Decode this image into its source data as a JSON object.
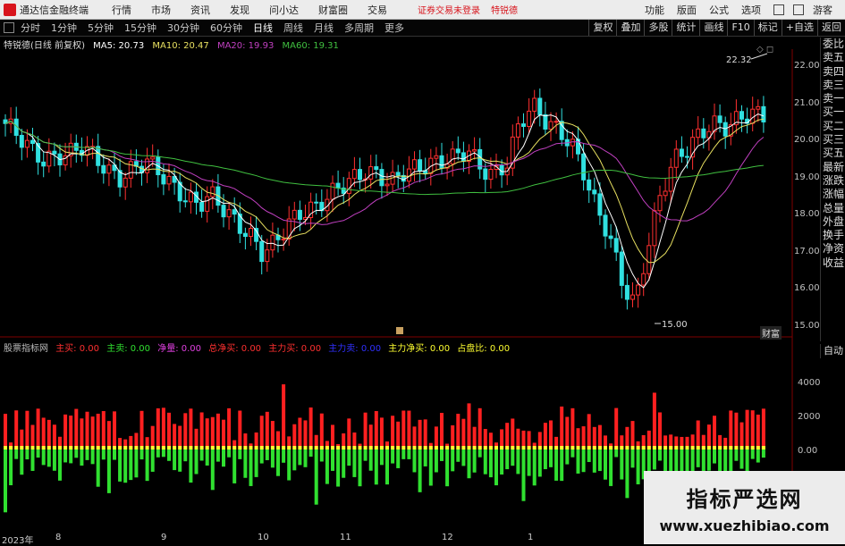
{
  "menubar": {
    "app_title": "通达信金融终端",
    "items": [
      "行情",
      "市场",
      "资讯",
      "发现",
      "问小达",
      "财富圈",
      "交易"
    ],
    "notice": "证券交易未登录",
    "notice2": "特锐德",
    "right": [
      "功能",
      "版面",
      "公式",
      "选项",
      "游客"
    ]
  },
  "periodbar": {
    "periods": [
      "分时",
      "1分钟",
      "5分钟",
      "15分钟",
      "30分钟",
      "60分钟",
      "日线",
      "周线",
      "月线",
      "多周期",
      "更多"
    ],
    "selected": "日线",
    "tools": [
      "复权",
      "叠加",
      "多股",
      "统计",
      "画线",
      "F10",
      "标记",
      "+自选",
      "返回"
    ]
  },
  "main_chart": {
    "stock": "特锐德(日线 前复权)",
    "ma": [
      {
        "label": "MA5: 20.73",
        "color": "#ffffff"
      },
      {
        "label": "MA10: 20.47",
        "color": "#e8e060"
      },
      {
        "label": "MA20: 19.93",
        "color": "#c040c0"
      },
      {
        "label": "MA60: 19.31",
        "color": "#40c040"
      }
    ],
    "price_ticks": [
      "22.00",
      "21.00",
      "20.00",
      "19.00",
      "18.00",
      "17.00",
      "16.00",
      "15.00"
    ],
    "high_marker": "22.32",
    "low_marker": "15.00",
    "corner_label": "财富"
  },
  "sidetabs": [
    "委比",
    "卖五",
    "卖四",
    "卖三",
    "卖一",
    "买一",
    "买二",
    "买三",
    "买五",
    "最新",
    "涨跌",
    "涨幅",
    "总量",
    "外盘",
    "换手",
    "净资",
    "收益"
  ],
  "auto_label": "自动",
  "indicator": {
    "name": "股票指标网",
    "fields": [
      {
        "label": "主买: 0.00",
        "color": "#ff3030"
      },
      {
        "label": "主卖: 0.00",
        "color": "#30e030"
      },
      {
        "label": "净量: 0.00",
        "color": "#e040e0"
      },
      {
        "label": "总净买: 0.00",
        "color": "#ff3030"
      },
      {
        "label": "主力买: 0.00",
        "color": "#ff3030"
      },
      {
        "label": "主力卖: 0.00",
        "color": "#3030ff"
      },
      {
        "label": "主力净买: 0.00",
        "color": "#ffff30"
      },
      {
        "label": "占盘比: 0.00",
        "color": "#ffff30"
      }
    ],
    "ticks": [
      "4000",
      "2000",
      "0.00"
    ]
  },
  "date_axis": [
    "2023年",
    "8",
    "9",
    "10",
    "11",
    "12",
    "1"
  ],
  "watermark": {
    "title": "指标严选网",
    "url": "www.xuezhibiao.com"
  },
  "colors": {
    "up": "#ff3030",
    "down": "#30e0e0",
    "vol_up": "#ff2020",
    "vol_down": "#30e030",
    "grid": "#800000"
  }
}
